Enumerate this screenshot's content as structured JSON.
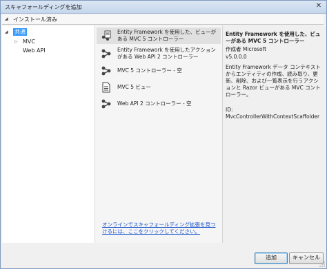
{
  "window": {
    "title": "スキャフォールディングを追加",
    "close_glyph": "✕"
  },
  "header": {
    "label": "インストール済み"
  },
  "tree": {
    "items": [
      {
        "label": "共通",
        "expander": "◢",
        "selected": true
      },
      {
        "label": "MVC",
        "expander": "▷"
      },
      {
        "label": "Web API"
      }
    ]
  },
  "templates": [
    {
      "label": "Entity Framework を使用した、ビューがある MVC 5 コントローラー",
      "icon": "controller-views-icon",
      "selected": true
    },
    {
      "label": "Entity Framework を使用したアクションがある Web API 2 コントローラー",
      "icon": "api-controller-icon"
    },
    {
      "label": "MVC 5 コントローラー - 空",
      "icon": "controller-icon"
    },
    {
      "label": "MVC 5 ビュー",
      "icon": "view-page-icon"
    },
    {
      "label": "Web API 2 コントローラー - 空",
      "icon": "api-controller-icon"
    }
  ],
  "online_link": "オンラインでスキャフォールディング拡張を見つけるには、ここをクリックしてください。",
  "details": {
    "title": "Entity Framework を使用した、ビューがある MVC 5 コントローラー",
    "author": "作成者 Microsoft",
    "version": "v5.0.0.0",
    "description": "Entity Framework データ コンテキストからエンティティの作成、読み取り、更新、削除、および一覧表示を行うアクションと Razor ビューがある MVC コントローラー。",
    "id": "ID: MvcControllerWithContextScaffolder"
  },
  "buttons": {
    "add": "追加",
    "cancel": "キャンセル"
  },
  "colors": {
    "selection": "#3399ff",
    "link": "#1a55cc",
    "selected_row": "#e0e0e0"
  }
}
